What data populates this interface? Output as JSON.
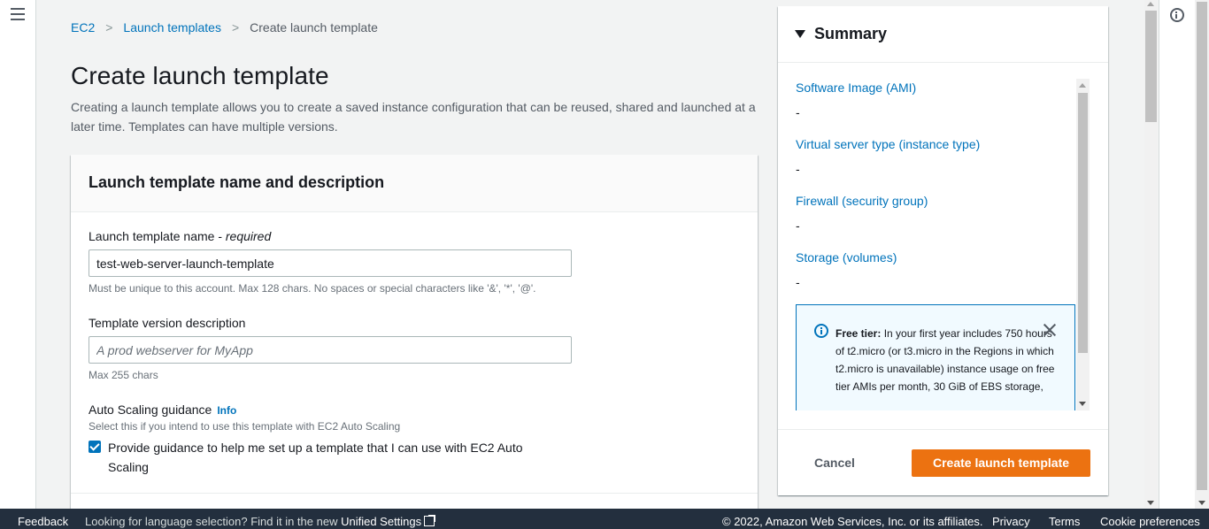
{
  "breadcrumb": {
    "items": [
      "EC2",
      "Launch templates"
    ],
    "current": "Create launch template"
  },
  "page": {
    "title": "Create launch template",
    "description": "Creating a launch template allows you to create a saved instance configuration that can be reused, shared and launched at a later time. Templates can have multiple versions."
  },
  "panel": {
    "title": "Launch template name and description",
    "name_label": "Launch template name - ",
    "name_required": "required",
    "name_value": "test-web-server-launch-template",
    "name_hint": "Must be unique to this account. Max 128 chars. No spaces or special characters like '&', '*', '@'.",
    "version_label": "Template version description",
    "version_placeholder": "A prod webserver for MyApp",
    "version_hint": "Max 255 chars",
    "autoscaling_label": "Auto Scaling guidance",
    "autoscaling_info": "Info",
    "autoscaling_hint": "Select this if you intend to use this template with EC2 Auto Scaling",
    "autoscaling_checkbox_label": "Provide guidance to help me set up a template that I can use with EC2 Auto Scaling",
    "autoscaling_checked": true
  },
  "summary": {
    "title": "Summary",
    "items": [
      {
        "label": "Software Image (AMI)",
        "value": "-"
      },
      {
        "label": "Virtual server type (instance type)",
        "value": "-"
      },
      {
        "label": "Firewall (security group)",
        "value": "-"
      },
      {
        "label": "Storage (volumes)",
        "value": "-"
      }
    ],
    "free_tier_heading": "Free tier:",
    "free_tier_text": " In your first year includes 750 hours of t2.micro (or t3.micro in the Regions in which t2.micro is unavailable) instance usage on free tier AMIs per month, 30 GiB of EBS storage,",
    "cancel_label": "Cancel",
    "create_label": "Create launch template"
  },
  "footer": {
    "feedback": "Feedback",
    "lang_text": "Looking for language selection? Find it in the new ",
    "lang_link": "Unified Settings",
    "copyright": "© 2022, Amazon Web Services, Inc. or its affiliates.",
    "privacy": "Privacy",
    "terms": "Terms",
    "cookie": "Cookie preferences"
  },
  "colors": {
    "accent": "#0073bb",
    "primary_button": "#ec7211",
    "footer_bg": "#232f3e"
  }
}
